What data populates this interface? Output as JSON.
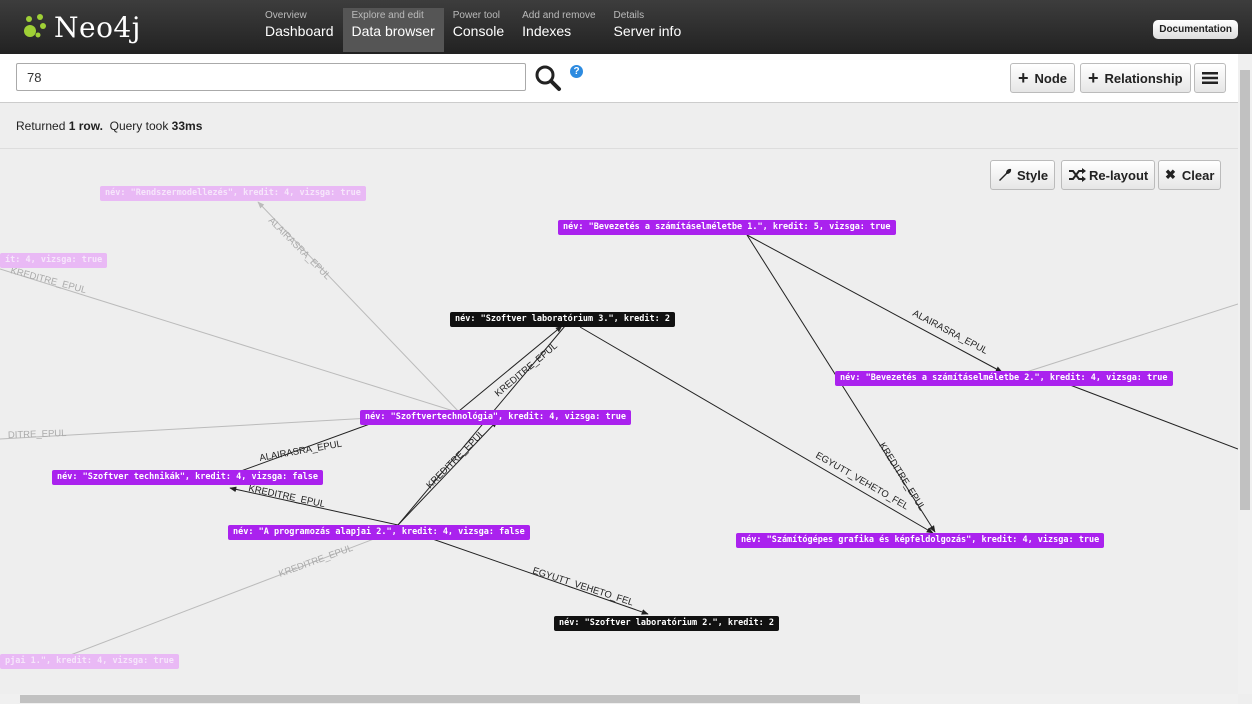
{
  "app": {
    "brand": "Neo4j",
    "doc_label": "Documentation"
  },
  "nav": [
    {
      "sub": "Overview",
      "main": "Dashboard"
    },
    {
      "sub": "Explore and edit",
      "main": "Data browser"
    },
    {
      "sub": "Power tool",
      "main": "Console"
    },
    {
      "sub": "Add and remove",
      "main": "Indexes"
    },
    {
      "sub": "Details",
      "main": "Server info"
    }
  ],
  "search": {
    "value": "78",
    "help": "?"
  },
  "actions": {
    "node": "Node",
    "relationship": "Relationship"
  },
  "status": {
    "prefix": "Returned",
    "rows": "1 row.",
    "query": "Query took",
    "time": "33ms"
  },
  "tools": {
    "style": "Style",
    "relayout": "Re-layout",
    "clear": "Clear"
  },
  "graph": {
    "nodes": [
      {
        "label": "név: \"Rendszermodellezés\", kredit: 4, vizsga: true"
      },
      {
        "label": "ít: 4, vizsga: true"
      },
      {
        "label": "név: \"Bevezetés a számításelméletbe 1.\", kredit: 5, vizsga: true"
      },
      {
        "label": "név: \"Szoftver laboratórium 3.\", kredit: 2"
      },
      {
        "label": "név: \"Bevezetés a számításelméletbe 2.\", kredit: 4, vizsga: true"
      },
      {
        "label": "név: \"Szoftvertechnológia\", kredit: 4, vizsga: true"
      },
      {
        "label": "név: \"Szoftver technikák\", kredit: 4, vizsga: false"
      },
      {
        "label": "név: \"A programozás alapjai 2.\", kredit: 4, vizsga: false"
      },
      {
        "label": "név: \"Számítógépes grafika és képfeldolgozás\", kredit: 4, vizsga: true"
      },
      {
        "label": "név: \"Szoftver laboratórium 2.\", kredit: 2"
      },
      {
        "label": "pjai 1.\", kredit: 4, vizsga: true"
      }
    ],
    "edges": {
      "alairasra_epul": "ALAIRASRA_EPUL",
      "kreditre_epul": "KREDITRE_EPUL",
      "egyutt_veheto_fel": "EGYUTT_VEHETO_FEL",
      "dit_re_epul": "DITRE_EPUL"
    }
  }
}
